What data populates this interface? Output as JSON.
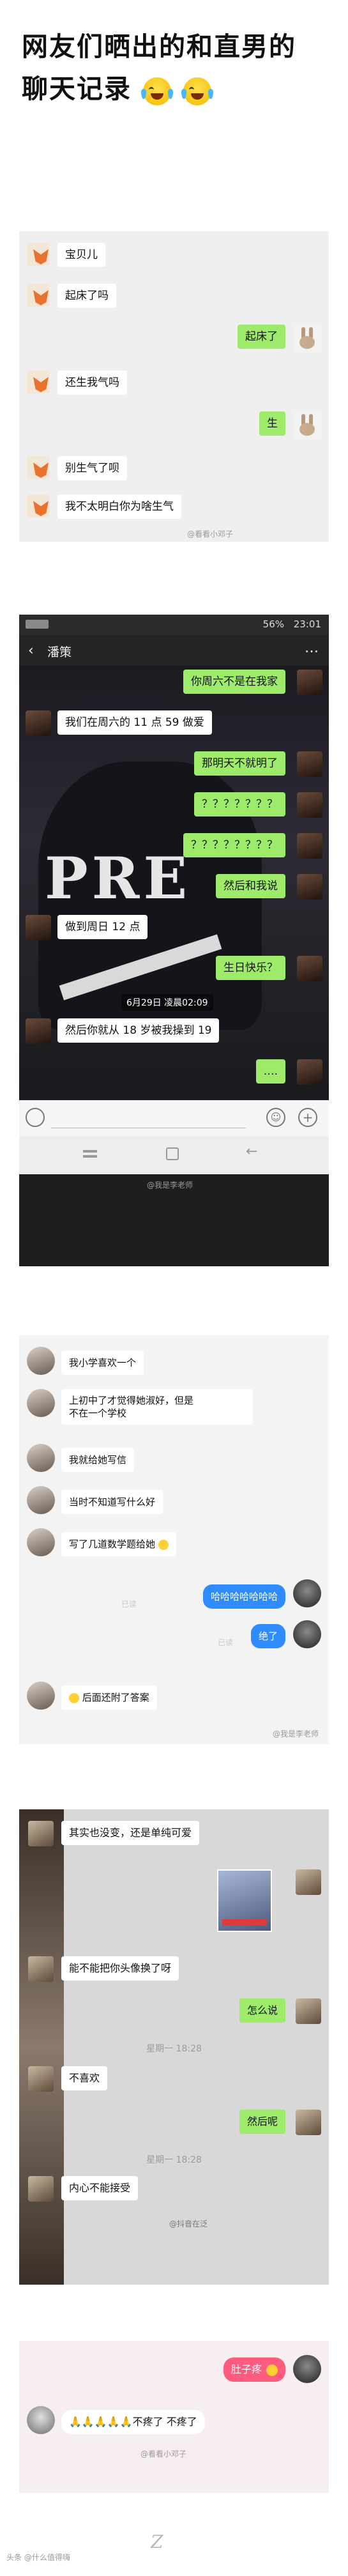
{
  "headline": {
    "line1": "网友们晒出的和直男的",
    "line2": "聊天记录"
  },
  "chat1": {
    "messages": [
      {
        "side": "left",
        "text": "宝贝儿"
      },
      {
        "side": "left",
        "text": "起床了吗"
      },
      {
        "side": "right",
        "text": "起床了"
      },
      {
        "side": "left",
        "text": "还生我气吗"
      },
      {
        "side": "right",
        "text": "生"
      },
      {
        "side": "left",
        "text": "别生气了呗"
      },
      {
        "side": "left",
        "text": "我不太明白你为啥生气"
      }
    ],
    "watermark": "@看看小邓子"
  },
  "chat2": {
    "status": {
      "battery": "56%",
      "time": "23:01"
    },
    "contact_name": "潘策",
    "more_icon": "more-icon",
    "messages": [
      {
        "side": "right",
        "text": "你周六不是在我家"
      },
      {
        "side": "left",
        "text": "我们在周六的 11 点 59 做爱"
      },
      {
        "side": "right",
        "text": "那明天不就明了"
      },
      {
        "side": "right",
        "text": "？？？？？？？"
      },
      {
        "side": "right",
        "text": "？？？？？？？？"
      },
      {
        "side": "right",
        "text": "然后和我说"
      },
      {
        "side": "left",
        "text": "做到周日 12 点"
      },
      {
        "side": "right",
        "text": "生日快乐？"
      },
      {
        "side": "left",
        "text": "然后你就从 18 岁被我操到 19"
      },
      {
        "side": "right",
        "text": "…."
      }
    ],
    "timestamp": "6月29日 凌晨02:09",
    "watermark": "@我是李老师"
  },
  "chat3": {
    "messages": [
      {
        "side": "left",
        "text": "我小学喜欢一个"
      },
      {
        "side": "left",
        "text": "上初中了才觉得她淑好，但是"
      },
      {
        "side": "left",
        "text": "不在一个学校"
      },
      {
        "side": "left",
        "text": "我就给她写信"
      },
      {
        "side": "left",
        "text": "当时不知道写什么好"
      },
      {
        "side": "left",
        "text": "写了几道数学题给她"
      },
      {
        "side": "right",
        "text": "哈哈哈哈哈哈哈"
      },
      {
        "side": "right",
        "text": "绝了"
      },
      {
        "side": "left",
        "text": "后面还附了答案"
      }
    ],
    "read_labels": [
      "已读",
      "已读"
    ],
    "watermark": "@我是李老师"
  },
  "chat4": {
    "messages": [
      {
        "side": "left",
        "text": "其实也没变，还是单纯可爱"
      },
      {
        "side": "left",
        "text": "能不能把你头像换了呀"
      },
      {
        "side": "right",
        "text": "怎么说"
      },
      {
        "side": "left",
        "text": "不喜欢"
      },
      {
        "side": "right",
        "text": "然后呢"
      },
      {
        "side": "left",
        "text": "内心不能接受"
      }
    ],
    "time_labels": [
      "星期一 18:28",
      "星期一 18:28"
    ],
    "watermark": "@抖音在泛"
  },
  "chat5": {
    "messages": [
      {
        "side": "right",
        "text": "肚子疼"
      },
      {
        "side": "left",
        "text": "🙏🙏🙏🙏🙏不疼了 不疼了"
      }
    ],
    "watermark": "@看看小邓子"
  },
  "footer": {
    "logo": "Z",
    "watermark": "头条 @什么值得嗨"
  }
}
